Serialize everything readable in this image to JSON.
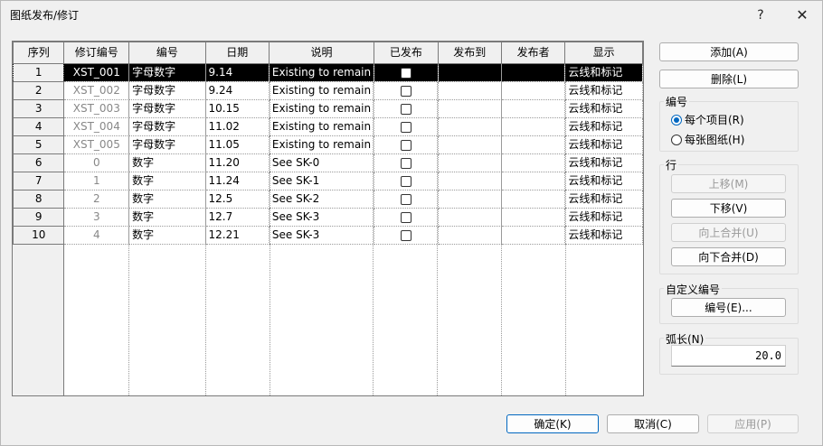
{
  "window": {
    "title": "图纸发布/修订",
    "help": "?",
    "close": "✕"
  },
  "table": {
    "headers": [
      "序列",
      "修订编号",
      "编号",
      "日期",
      "说明",
      "已发布",
      "发布到",
      "发布者",
      "显示"
    ],
    "rows": [
      {
        "seq": "1",
        "rev": "XST_001",
        "numbering": "字母数字",
        "date": "9.14",
        "desc": "Existing to remain",
        "show": "云线和标记"
      },
      {
        "seq": "2",
        "rev": "XST_002",
        "numbering": "字母数字",
        "date": "9.24",
        "desc": "Existing to remain",
        "show": "云线和标记"
      },
      {
        "seq": "3",
        "rev": "XST_003",
        "numbering": "字母数字",
        "date": "10.15",
        "desc": "Existing to remain",
        "show": "云线和标记"
      },
      {
        "seq": "4",
        "rev": "XST_004",
        "numbering": "字母数字",
        "date": "11.02",
        "desc": "Existing to remain",
        "show": "云线和标记"
      },
      {
        "seq": "5",
        "rev": "XST_005",
        "numbering": "字母数字",
        "date": "11.05",
        "desc": "Existing to remain",
        "show": "云线和标记"
      },
      {
        "seq": "6",
        "rev": "0",
        "numbering": "数字",
        "date": "11.20",
        "desc": "See SK-0",
        "show": "云线和标记"
      },
      {
        "seq": "7",
        "rev": "1",
        "numbering": "数字",
        "date": "11.24",
        "desc": "See SK-1",
        "show": "云线和标记"
      },
      {
        "seq": "8",
        "rev": "2",
        "numbering": "数字",
        "date": "12.5",
        "desc": "See SK-2",
        "show": "云线和标记"
      },
      {
        "seq": "9",
        "rev": "3",
        "numbering": "数字",
        "date": "12.7",
        "desc": "See SK-3",
        "show": "云线和标记"
      },
      {
        "seq": "10",
        "rev": "4",
        "numbering": "数字",
        "date": "12.21",
        "desc": "See SK-3",
        "show": "云线和标记"
      }
    ]
  },
  "side": {
    "add": "添加(A)",
    "delete": "删除(L)",
    "numbering_group": "编号",
    "per_project": "每个项目(R)",
    "per_sheet": "每张图纸(H)",
    "row_group": "行",
    "move_up": "上移(M)",
    "move_down": "下移(V)",
    "merge_up": "向上合并(U)",
    "merge_down": "向下合并(D)",
    "custom_group": "自定义编号",
    "numbering_btn": "编号(E)...",
    "arc_group": "弧长(N)",
    "arc_value": "20.0"
  },
  "footer": {
    "ok": "确定(K)",
    "cancel": "取消(C)",
    "apply": "应用(P)"
  }
}
